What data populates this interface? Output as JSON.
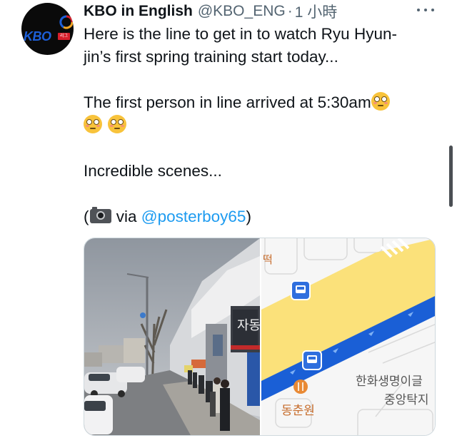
{
  "tweet": {
    "author_name": "KBO in English",
    "handle": "@KBO_ENG",
    "separator": "·",
    "time": "1 小時",
    "avatar_logo": "KBO",
    "avatar_sub": "리그",
    "text_line1": "Here is the line to get in to watch Ryu Hyun-",
    "text_line2": "jin’s first spring training start today...",
    "text_line3": "The first person in line arrived at 5:30am",
    "text_line5": "Incredible scenes...",
    "via_open": "(",
    "via_word": " via ",
    "via_mention": "@posterboy65",
    "via_close": ")",
    "emoji": "flushed-face-icon"
  },
  "media": {
    "photo_sign": "자동",
    "map_labels": {
      "top_fragment": "떡",
      "building": "한화생명이글",
      "building_sub": "중앙탁지",
      "restaurant": "동춘원"
    }
  },
  "colors": {
    "link": "#1d9bf0",
    "text": "#0f1419",
    "muted": "#536471",
    "map_road": "#1a5fd6",
    "map_highlight": "#fbe17a"
  }
}
